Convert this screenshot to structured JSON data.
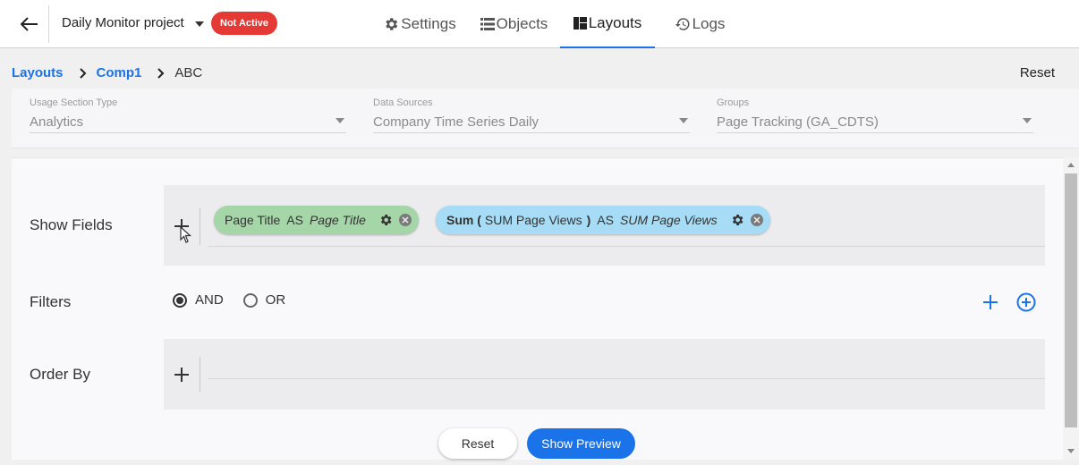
{
  "header": {
    "project_name": "Daily Monitor project",
    "status": "Not Active",
    "tabs": [
      {
        "label": "Settings",
        "icon": "gear-icon"
      },
      {
        "label": "Objects",
        "icon": "list-icon"
      },
      {
        "label": "Layouts",
        "icon": "dashboard-icon",
        "active": true
      },
      {
        "label": "Logs",
        "icon": "history-icon"
      }
    ]
  },
  "breadcrumb": {
    "items": [
      "Layouts",
      "Comp1",
      "ABC"
    ],
    "reset_label": "Reset"
  },
  "selects": [
    {
      "label": "Usage Section Type",
      "value": "Analytics"
    },
    {
      "label": "Data Sources",
      "value": "Company Time Series Daily"
    },
    {
      "label": "Groups",
      "value": "Page Tracking (GA_CDTS)"
    }
  ],
  "show_fields": {
    "label": "Show Fields",
    "chips": [
      {
        "field": "Page Title",
        "as": "AS",
        "alias": "Page Title"
      },
      {
        "func": "Sum (",
        "field": "SUM Page Views",
        "close": ")",
        "as": "AS",
        "alias": "SUM Page Views"
      }
    ]
  },
  "filters": {
    "label": "Filters",
    "options": [
      "AND",
      "OR"
    ],
    "selected": "AND"
  },
  "order_by": {
    "label": "Order By"
  },
  "actions": {
    "reset_label": "Reset",
    "preview_label": "Show Preview"
  },
  "colors": {
    "accent": "#1a73e8",
    "status_red": "#e53935",
    "chip_green": "#a5d6a7",
    "chip_blue": "#a6dcf5"
  }
}
